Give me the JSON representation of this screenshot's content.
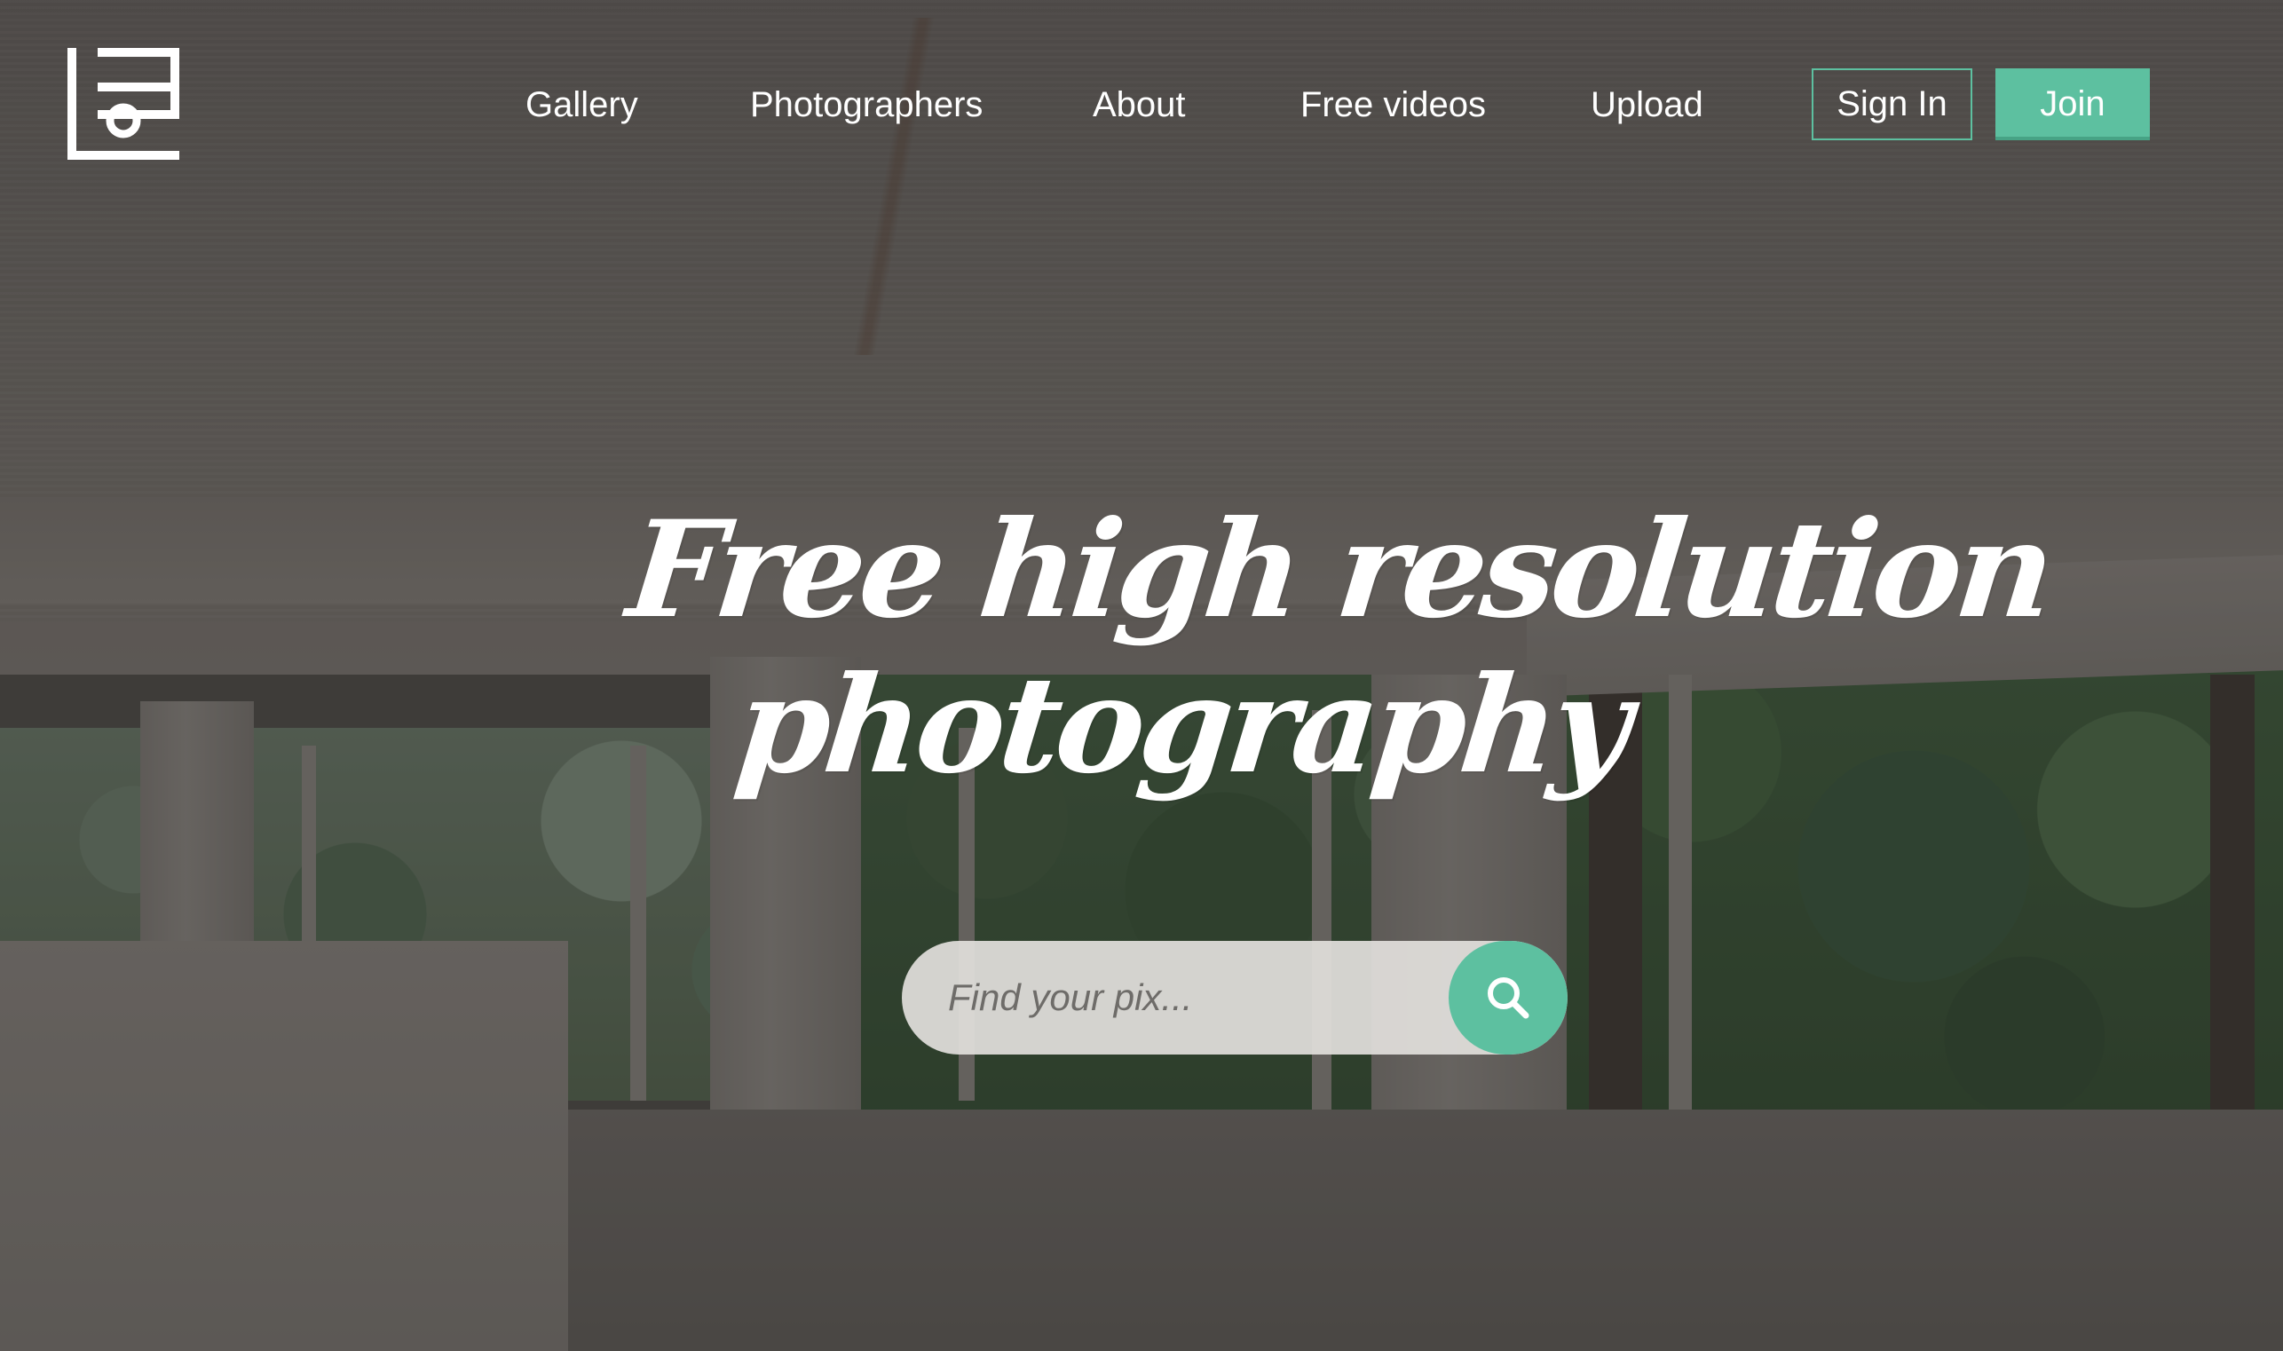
{
  "nav": {
    "links": [
      {
        "label": "Gallery"
      },
      {
        "label": "Photographers"
      },
      {
        "label": "About"
      },
      {
        "label": "Free videos"
      },
      {
        "label": "Upload"
      }
    ],
    "sign_in_label": "Sign In",
    "join_label": "Join"
  },
  "logo": {
    "icon": "logo-icon"
  },
  "hero": {
    "headline_line1": "Free high resolution",
    "headline_line2": "photography"
  },
  "search": {
    "placeholder": "Find your pix...",
    "value": "",
    "icon": "search-icon"
  },
  "colors": {
    "accent": "#5dc0a0",
    "text": "#ffffff",
    "search_field_bg": "#e1dfdc"
  }
}
